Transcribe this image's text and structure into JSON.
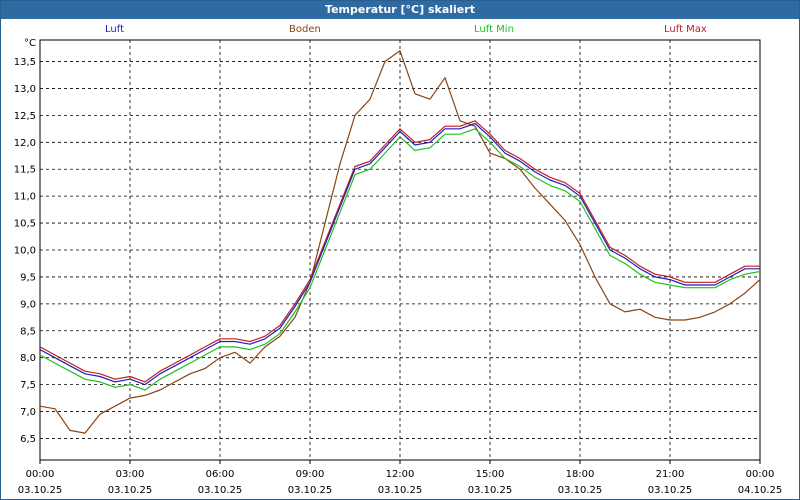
{
  "title": "Temperatur [°C] skaliert",
  "unit_label": "°C",
  "chart_data": {
    "type": "line",
    "title": "Temperatur [°C] skaliert",
    "ylabel": "°C",
    "xlim": [
      0,
      24
    ],
    "ylim": [
      6.1,
      13.9
    ],
    "grid": true,
    "legend": "top",
    "yticks": [
      6.5,
      7.0,
      7.5,
      8.0,
      8.5,
      9.0,
      9.5,
      10.0,
      10.5,
      11.0,
      11.5,
      12.0,
      12.5,
      13.0,
      13.5
    ],
    "ytick_labels": [
      "6,5",
      "7,0",
      "7,5",
      "8,0",
      "8,5",
      "9,0",
      "9,5",
      "10,0",
      "10,5",
      "11,0",
      "11,5",
      "12,0",
      "12,5",
      "13,0",
      "13,5"
    ],
    "xticks": [
      {
        "time": "00:00",
        "date": "03.10.25"
      },
      {
        "time": "03:00",
        "date": "03.10.25"
      },
      {
        "time": "06:00",
        "date": "03.10.25"
      },
      {
        "time": "09:00",
        "date": "03.10.25"
      },
      {
        "time": "12:00",
        "date": "03.10.25"
      },
      {
        "time": "15:00",
        "date": "03.10.25"
      },
      {
        "time": "18:00",
        "date": "03.10.25"
      },
      {
        "time": "21:00",
        "date": "03.10.25"
      },
      {
        "time": "00:00",
        "date": "04.10.25"
      }
    ],
    "x": [
      0,
      0.5,
      1,
      1.5,
      2,
      2.5,
      3,
      3.5,
      4,
      4.5,
      5,
      5.5,
      6,
      6.5,
      7,
      7.5,
      8,
      8.5,
      9,
      9.5,
      10,
      10.5,
      11,
      11.5,
      12,
      12.5,
      13,
      13.5,
      14,
      14.5,
      15,
      15.5,
      16,
      16.5,
      17,
      17.5,
      18,
      18.5,
      19,
      19.5,
      20,
      20.5,
      21,
      21.5,
      22,
      22.5,
      23,
      23.5,
      24
    ],
    "series": [
      {
        "name": "Luft",
        "color": "#2020c0",
        "values": [
          8.15,
          8.0,
          7.85,
          7.7,
          7.65,
          7.55,
          7.6,
          7.5,
          7.7,
          7.85,
          8.0,
          8.15,
          8.3,
          8.3,
          8.25,
          8.35,
          8.55,
          8.95,
          9.4,
          10.1,
          10.8,
          11.5,
          11.6,
          11.9,
          12.2,
          11.95,
          12.0,
          12.25,
          12.25,
          12.35,
          12.1,
          11.8,
          11.65,
          11.45,
          11.3,
          11.2,
          11.0,
          10.5,
          10.0,
          9.85,
          9.65,
          9.5,
          9.45,
          9.35,
          9.35,
          9.35,
          9.5,
          9.65,
          9.65
        ]
      },
      {
        "name": "Boden",
        "color": "#8b4513",
        "values": [
          7.1,
          7.05,
          6.65,
          6.6,
          6.95,
          7.1,
          7.25,
          7.3,
          7.4,
          7.55,
          7.7,
          7.8,
          8.0,
          8.1,
          7.9,
          8.2,
          8.4,
          8.75,
          9.4,
          10.5,
          11.6,
          12.5,
          12.8,
          13.5,
          13.7,
          12.9,
          12.8,
          13.2,
          12.4,
          12.3,
          11.8,
          11.7,
          11.5,
          11.15,
          10.85,
          10.55,
          10.1,
          9.5,
          9.0,
          8.85,
          8.9,
          8.75,
          8.7,
          8.7,
          8.75,
          8.85,
          9.0,
          9.2,
          9.45
        ]
      },
      {
        "name": "Luft Min",
        "color": "#20c020",
        "values": [
          8.05,
          7.9,
          7.75,
          7.6,
          7.55,
          7.45,
          7.5,
          7.4,
          7.6,
          7.75,
          7.9,
          8.05,
          8.2,
          8.2,
          8.15,
          8.25,
          8.45,
          8.85,
          9.3,
          10.0,
          10.7,
          11.4,
          11.5,
          11.8,
          12.1,
          11.85,
          11.9,
          12.15,
          12.15,
          12.25,
          12.0,
          11.7,
          11.55,
          11.35,
          11.2,
          11.1,
          10.9,
          10.4,
          9.9,
          9.75,
          9.55,
          9.4,
          9.35,
          9.3,
          9.3,
          9.3,
          9.45,
          9.55,
          9.6
        ]
      },
      {
        "name": "Luft Max",
        "color": "#c02020",
        "values": [
          8.2,
          8.05,
          7.9,
          7.75,
          7.7,
          7.6,
          7.65,
          7.55,
          7.75,
          7.9,
          8.05,
          8.2,
          8.35,
          8.35,
          8.3,
          8.4,
          8.6,
          9.0,
          9.45,
          10.15,
          10.85,
          11.55,
          11.65,
          11.95,
          12.25,
          12.0,
          12.05,
          12.3,
          12.3,
          12.4,
          12.15,
          11.85,
          11.7,
          11.5,
          11.35,
          11.25,
          11.05,
          10.55,
          10.05,
          9.9,
          9.7,
          9.55,
          9.5,
          9.4,
          9.4,
          9.4,
          9.55,
          9.7,
          9.7
        ]
      }
    ]
  }
}
